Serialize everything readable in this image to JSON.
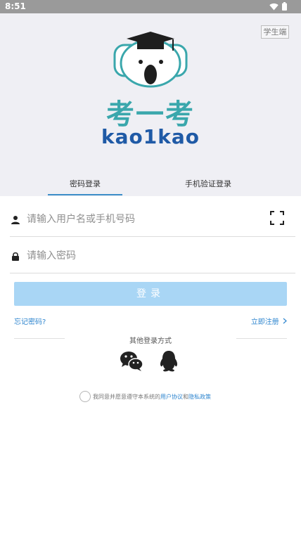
{
  "status_bar": {
    "time": "8:51"
  },
  "header": {
    "role_badge": "学生端",
    "logo_cn": "考一考",
    "logo_en": "kao1kao"
  },
  "tabs": [
    {
      "label": "密码登录",
      "active": true
    },
    {
      "label": "手机验证登录",
      "active": false
    }
  ],
  "form": {
    "username_placeholder": "请输入用户名或手机号码",
    "password_placeholder": "请输入密码",
    "login_label": "登录"
  },
  "links": {
    "forgot": "忘记密码?",
    "register": "立即注册"
  },
  "other_methods": {
    "label": "其他登录方式",
    "icons": [
      "wechat-icon",
      "qq-icon"
    ]
  },
  "agreement": {
    "prefix": "我同意并愿意遵守本系统的",
    "user_agreement": "用户协议",
    "and": "和",
    "privacy_policy": "隐私政策"
  },
  "colors": {
    "accent": "#2f86cf",
    "button": "#a9d6f5",
    "logo_teal": "#3aa7ac",
    "logo_blue": "#1f5aa6"
  }
}
